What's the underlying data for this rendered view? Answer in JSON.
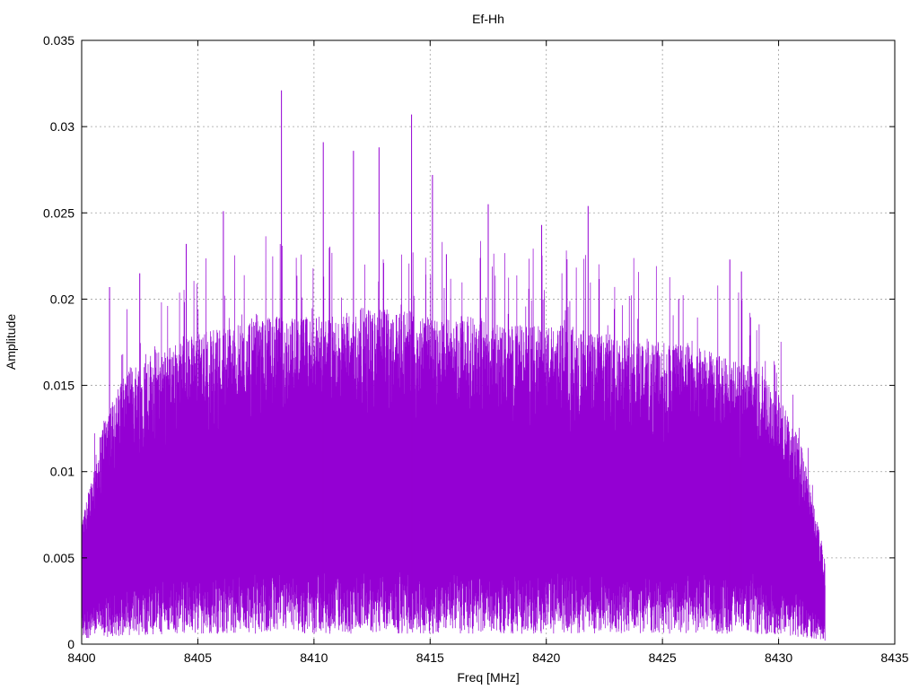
{
  "chart_data": {
    "type": "line",
    "title": "Ef-Hh",
    "xlabel": "Freq [MHz]",
    "ylabel": "Amplitude",
    "xlim": [
      8400,
      8435
    ],
    "ylim": [
      0,
      0.035
    ],
    "x_ticks": [
      "8400",
      "8405",
      "8410",
      "8415",
      "8420",
      "8425",
      "8430",
      "8435"
    ],
    "y_ticks": [
      "0",
      "0.005",
      "0.01",
      "0.015",
      "0.02",
      "0.025",
      "0.03",
      "0.035"
    ],
    "grid": true,
    "series": [
      {
        "color": "#9400d3",
        "x_range": [
          8400,
          8432
        ],
        "envelope_x": [
          8400,
          8401,
          8402,
          8403,
          8404,
          8405,
          8406,
          8407,
          8408,
          8409,
          8410,
          8411,
          8412,
          8413,
          8414,
          8415,
          8416,
          8417,
          8418,
          8419,
          8420,
          8421,
          8422,
          8423,
          8424,
          8425,
          8426,
          8427,
          8428,
          8429,
          8430,
          8431,
          8432
        ],
        "envelope_upper": [
          0.007,
          0.0135,
          0.016,
          0.017,
          0.0175,
          0.018,
          0.0185,
          0.0185,
          0.019,
          0.019,
          0.019,
          0.019,
          0.0195,
          0.0195,
          0.0195,
          0.019,
          0.019,
          0.019,
          0.0185,
          0.0185,
          0.0185,
          0.0185,
          0.018,
          0.018,
          0.018,
          0.0175,
          0.0175,
          0.017,
          0.0165,
          0.016,
          0.0145,
          0.0115,
          0.005
        ],
        "envelope_lower": [
          0.0015,
          0.002,
          0.0025,
          0.0025,
          0.003,
          0.003,
          0.003,
          0.003,
          0.003,
          0.003,
          0.003,
          0.003,
          0.003,
          0.003,
          0.003,
          0.003,
          0.003,
          0.003,
          0.003,
          0.003,
          0.003,
          0.003,
          0.003,
          0.003,
          0.003,
          0.003,
          0.003,
          0.003,
          0.003,
          0.003,
          0.0025,
          0.002,
          0.001
        ],
        "peaks": [
          {
            "x": 8401.2,
            "y": 0.0207
          },
          {
            "x": 8402.5,
            "y": 0.0215
          },
          {
            "x": 8404.5,
            "y": 0.0232
          },
          {
            "x": 8406.1,
            "y": 0.0251
          },
          {
            "x": 8408.6,
            "y": 0.0321
          },
          {
            "x": 8410.4,
            "y": 0.0291
          },
          {
            "x": 8411.7,
            "y": 0.0286
          },
          {
            "x": 8412.8,
            "y": 0.0288
          },
          {
            "x": 8414.2,
            "y": 0.0307
          },
          {
            "x": 8415.1,
            "y": 0.0272
          },
          {
            "x": 8415.7,
            "y": 0.0226
          },
          {
            "x": 8417.5,
            "y": 0.0255
          },
          {
            "x": 8419.8,
            "y": 0.0243
          },
          {
            "x": 8421.8,
            "y": 0.0254
          },
          {
            "x": 8425.7,
            "y": 0.02
          },
          {
            "x": 8427.9,
            "y": 0.0223
          },
          {
            "x": 8428.4,
            "y": 0.0216
          }
        ]
      }
    ]
  }
}
